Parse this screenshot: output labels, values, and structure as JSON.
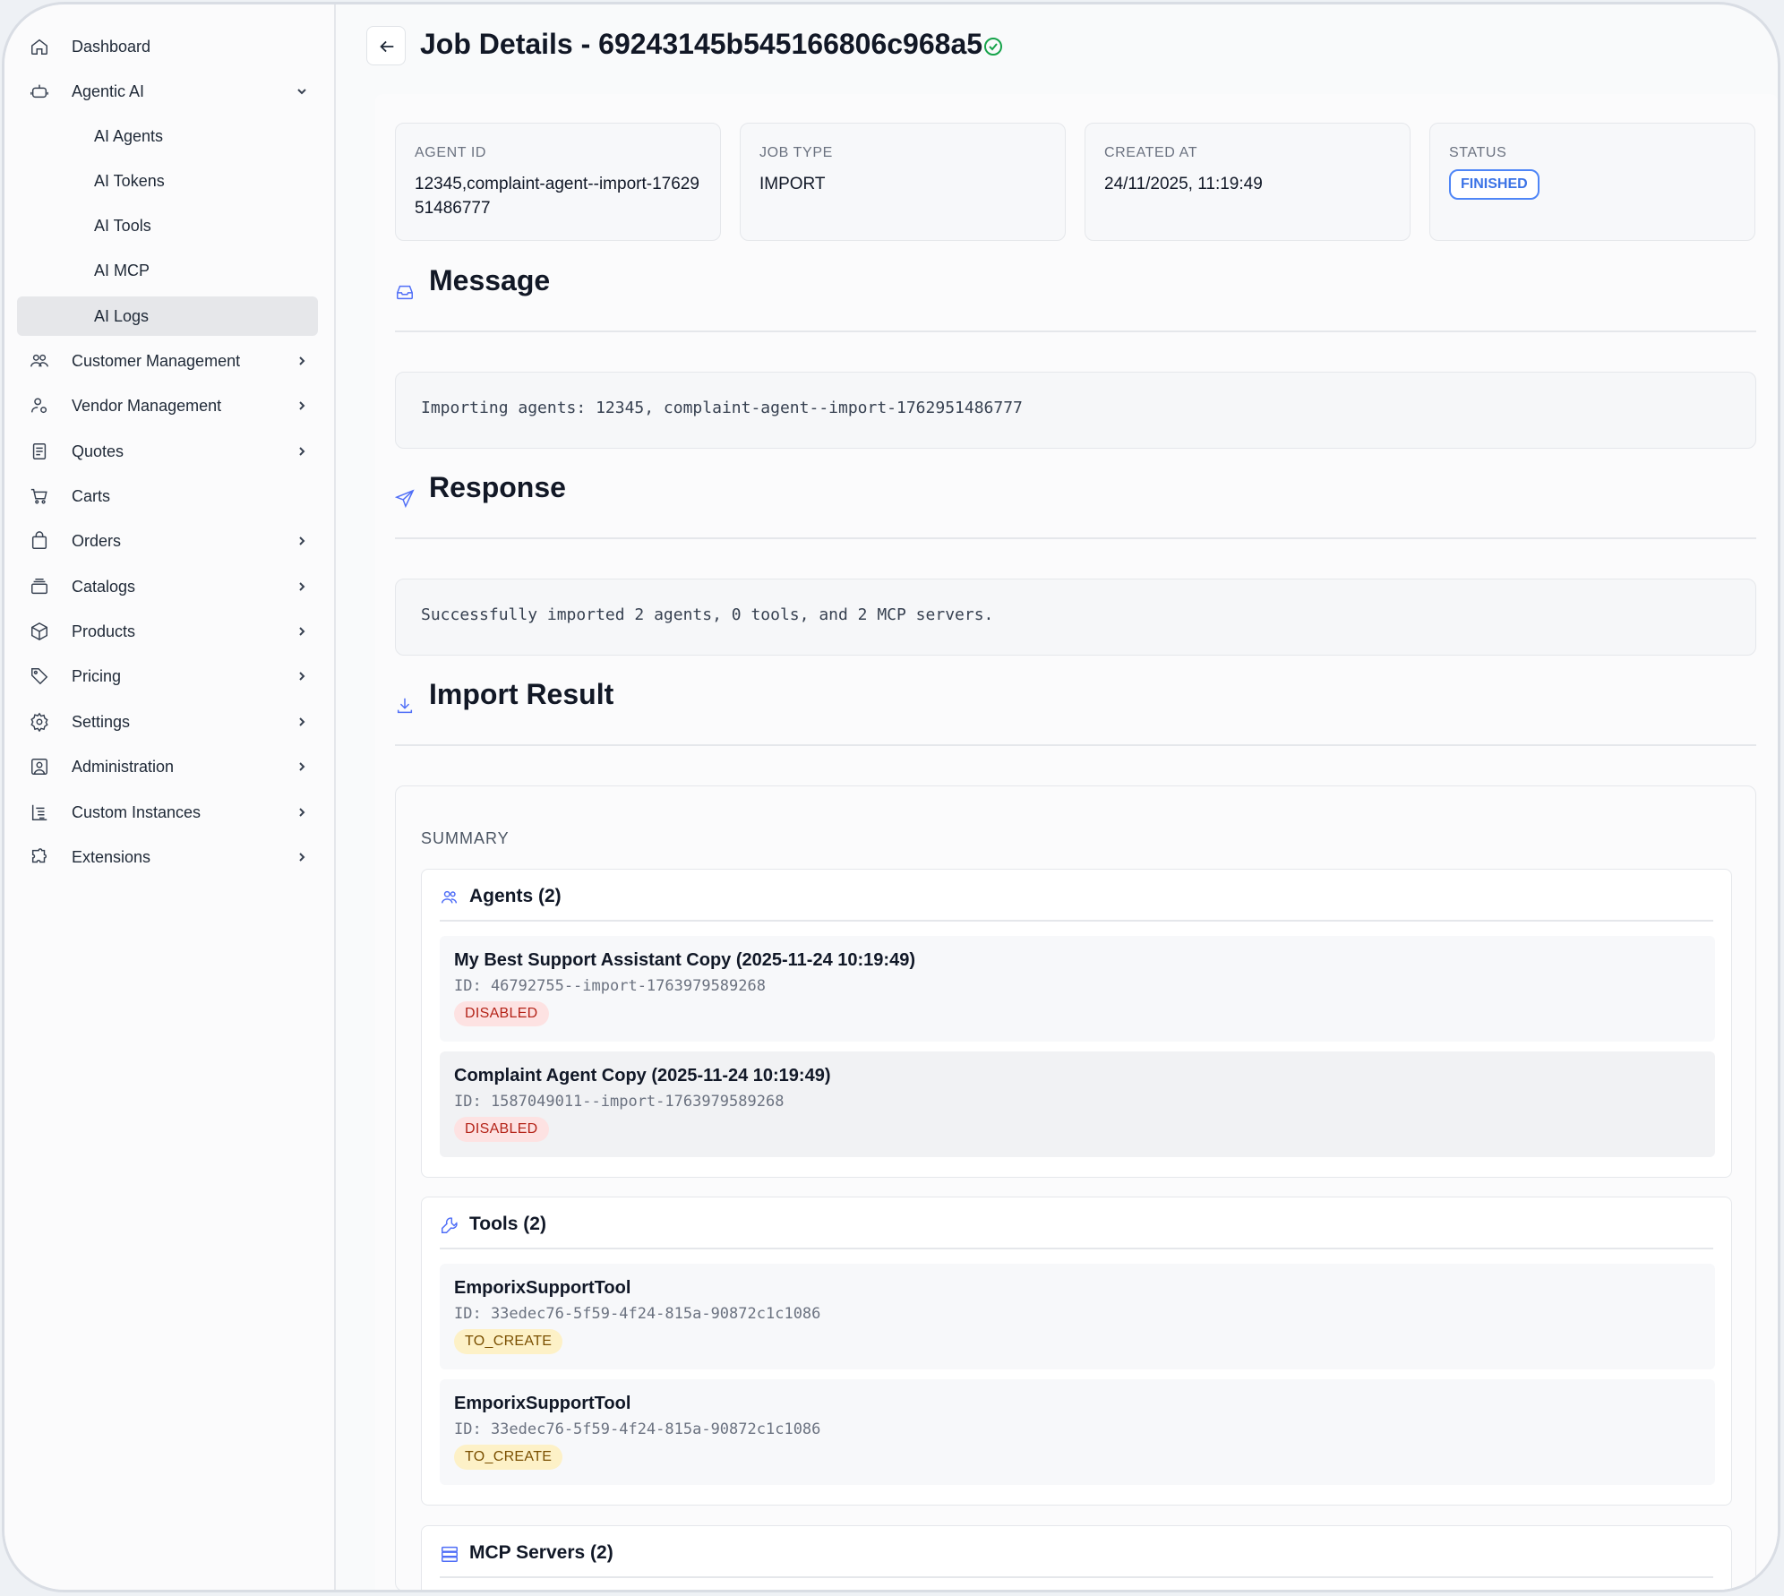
{
  "sidebar": {
    "items": [
      {
        "label": "Dashboard",
        "icon": "home-icon"
      },
      {
        "label": "Agentic AI",
        "icon": "robot-icon",
        "expanded": true
      },
      {
        "label": "AI Agents"
      },
      {
        "label": "AI Tokens"
      },
      {
        "label": "AI Tools"
      },
      {
        "label": "AI MCP"
      },
      {
        "label": "AI Logs",
        "active": true
      },
      {
        "label": "Customer Management",
        "icon": "users-icon"
      },
      {
        "label": "Vendor Management",
        "icon": "vendor-icon"
      },
      {
        "label": "Quotes",
        "icon": "document-icon"
      },
      {
        "label": "Carts",
        "icon": "cart-icon"
      },
      {
        "label": "Orders",
        "icon": "bag-icon"
      },
      {
        "label": "Catalogs",
        "icon": "catalog-icon"
      },
      {
        "label": "Products",
        "icon": "box-icon"
      },
      {
        "label": "Pricing",
        "icon": "tag-icon"
      },
      {
        "label": "Settings",
        "icon": "gear-icon"
      },
      {
        "label": "Administration",
        "icon": "admin-icon"
      },
      {
        "label": "Custom Instances",
        "icon": "list-tree-icon"
      },
      {
        "label": "Extensions",
        "icon": "puzzle-icon"
      }
    ]
  },
  "header": {
    "title": "Job Details - 69243145b545166806c968a5"
  },
  "info": {
    "agent_id_label": "AGENT ID",
    "agent_id_value": "12345,complaint-agent--import-1762951486777",
    "job_type_label": "JOB TYPE",
    "job_type_value": "IMPORT",
    "created_at_label": "CREATED AT",
    "created_at_value": "24/11/2025, 11:19:49",
    "status_label": "STATUS",
    "status_value": "FINISHED"
  },
  "message": {
    "title": "Message",
    "text": "Importing agents: 12345, complaint-agent--import-1762951486777"
  },
  "response": {
    "title": "Response",
    "text": "Successfully imported 2 agents, 0 tools, and 2 MCP servers."
  },
  "import_result": {
    "title": "Import Result",
    "summary_label": "SUMMARY",
    "agents": {
      "title": "Agents (2)",
      "items": [
        {
          "name": "My Best Support Assistant Copy (2025-11-24 10:19:49)",
          "id": "ID: 46792755--import-1763979589268",
          "status": "DISABLED"
        },
        {
          "name": "Complaint Agent Copy (2025-11-24 10:19:49)",
          "id": "ID: 1587049011--import-1763979589268",
          "status": "DISABLED"
        }
      ]
    },
    "tools": {
      "title": "Tools (2)",
      "items": [
        {
          "name": "EmporixSupportTool",
          "id": "ID: 33edec76-5f59-4f24-815a-90872c1c1086",
          "status": "TO_CREATE"
        },
        {
          "name": "EmporixSupportTool",
          "id": "ID: 33edec76-5f59-4f24-815a-90872c1c1086",
          "status": "TO_CREATE"
        }
      ]
    },
    "mcp": {
      "title": "MCP Servers (2)"
    }
  },
  "colors": {
    "accent": "#4f86f7",
    "success": "#16a34a",
    "danger_bg": "#fde2e2",
    "warning_bg": "#fdf1c7"
  }
}
